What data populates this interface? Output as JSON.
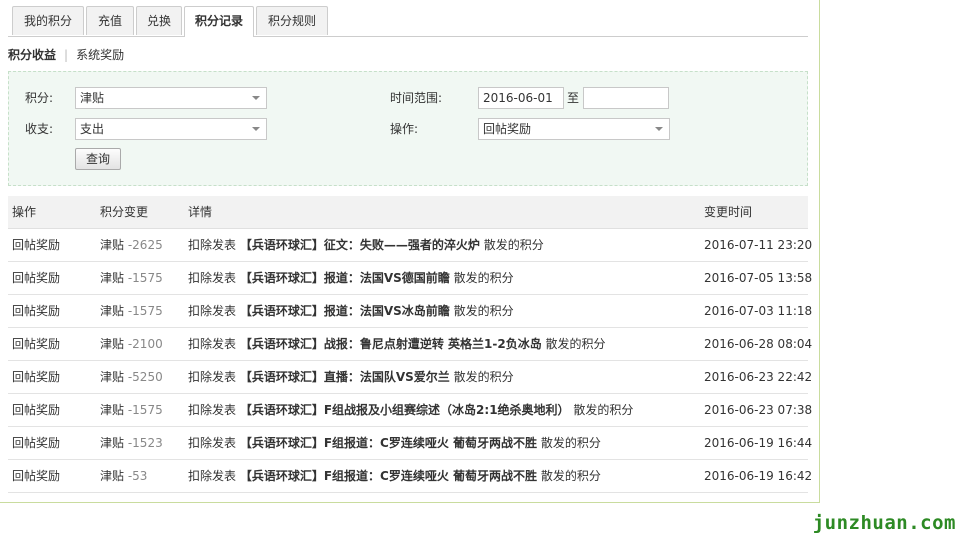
{
  "tabs": [
    "我的积分",
    "充值",
    "兑换",
    "积分记录",
    "积分规则"
  ],
  "active_tab": 3,
  "subnav": {
    "current": "积分收益",
    "separator": "|",
    "other": "系统奖励"
  },
  "filter": {
    "credit_label": "积分:",
    "credit_value": "津贴",
    "income_label": "收支:",
    "income_value": "支出",
    "time_label": "时间范围:",
    "time_start": "2016-06-01",
    "time_to": "至",
    "time_end": "",
    "op_label": "操作:",
    "op_value": "回帖奖励",
    "query_button": "查询"
  },
  "table": {
    "headers": {
      "op": "操作",
      "change": "积分变更",
      "detail": "详情",
      "time": "变更时间"
    },
    "rows": [
      {
        "op": "回帖奖励",
        "currency": "津贴",
        "amount": "-2625",
        "prefix": "扣除发表",
        "title": "【兵语环球汇】征文：失败——强者的淬火炉",
        "suffix": "散发的积分",
        "time": "2016-07-11 23:20"
      },
      {
        "op": "回帖奖励",
        "currency": "津贴",
        "amount": "-1575",
        "prefix": "扣除发表",
        "title": "【兵语环球汇】报道：法国VS德国前瞻",
        "suffix": "散发的积分",
        "time": "2016-07-05 13:58"
      },
      {
        "op": "回帖奖励",
        "currency": "津贴",
        "amount": "-1575",
        "prefix": "扣除发表",
        "title": "【兵语环球汇】报道：法国VS冰岛前瞻",
        "suffix": "散发的积分",
        "time": "2016-07-03 11:18"
      },
      {
        "op": "回帖奖励",
        "currency": "津贴",
        "amount": "-2100",
        "prefix": "扣除发表",
        "title": "【兵语环球汇】战报：鲁尼点射遭逆转 英格兰1-2负冰岛",
        "suffix": "散发的积分",
        "time": "2016-06-28 08:04"
      },
      {
        "op": "回帖奖励",
        "currency": "津贴",
        "amount": "-5250",
        "prefix": "扣除发表",
        "title": "【兵语环球汇】直播：法国队VS爱尔兰",
        "suffix": "散发的积分",
        "time": "2016-06-23 22:42"
      },
      {
        "op": "回帖奖励",
        "currency": "津贴",
        "amount": "-1575",
        "prefix": "扣除发表",
        "title": "【兵语环球汇】F组战报及小组赛综述（冰岛2:1绝杀奥地利）",
        "suffix": "散发的积分",
        "time": "2016-06-23 07:38"
      },
      {
        "op": "回帖奖励",
        "currency": "津贴",
        "amount": "-1523",
        "prefix": "扣除发表",
        "title": "【兵语环球汇】F组报道：C罗连续哑火 葡萄牙两战不胜",
        "suffix": "散发的积分",
        "time": "2016-06-19 16:44"
      },
      {
        "op": "回帖奖励",
        "currency": "津贴",
        "amount": "-53",
        "prefix": "扣除发表",
        "title": "【兵语环球汇】F组报道：C罗连续哑火 葡萄牙两战不胜",
        "suffix": "散发的积分",
        "time": "2016-06-19 16:42"
      }
    ]
  },
  "watermark": "junzhuan.com",
  "colors": {
    "watermark": "#2d8a24",
    "filter_bg": "#f1f8f3",
    "amount": "#888888"
  }
}
